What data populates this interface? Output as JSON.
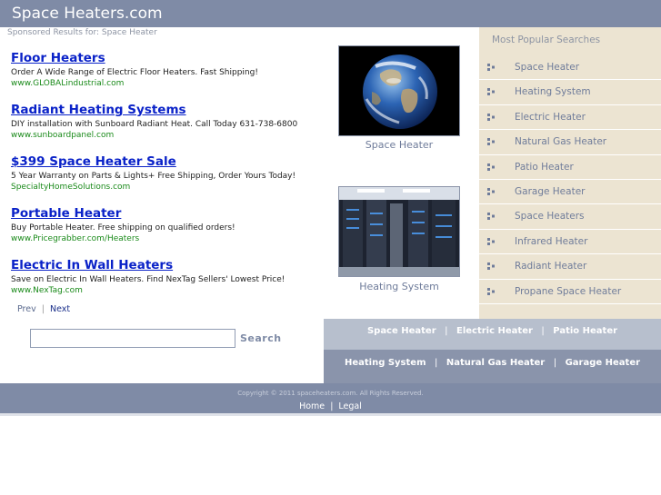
{
  "header": {
    "title": "Space Heaters.com"
  },
  "sponsored_label": "Sponsored Results for: Space Heater",
  "ads": [
    {
      "title": "Floor Heaters",
      "description": "Order A Wide Range of Electric Floor Heaters. Fast Shipping!",
      "url": "www.GLOBALindustrial.com"
    },
    {
      "title": "Radiant Heating Systems",
      "description": "DIY installation with Sunboard Radiant Heat. Call Today 631-738-6800",
      "url": "www.sunboardpanel.com"
    },
    {
      "title": "$399 Space Heater Sale",
      "description": "5 Year Warranty on Parts & Lights+ Free Shipping, Order Yours Today!",
      "url": "SpecialtyHomeSolutions.com"
    },
    {
      "title": "Portable Heater",
      "description": "Buy Portable Heater. Free shipping on qualified orders!",
      "url": "www.Pricegrabber.com/Heaters"
    },
    {
      "title": "Electric In Wall Heaters",
      "description": "Save on Electric In Wall Heaters. Find NexTag Sellers' Lowest Price!",
      "url": "www.NexTag.com"
    }
  ],
  "pager": {
    "prev": "Prev",
    "separator": "|",
    "next": "Next"
  },
  "search": {
    "value": "",
    "button": "Search"
  },
  "thumbnails": [
    {
      "caption": "Space Heater",
      "icon": "earth-image"
    },
    {
      "caption": "Heating System",
      "icon": "server-room-image"
    }
  ],
  "popular": {
    "heading": "Most Popular Searches",
    "items": [
      "Space Heater",
      "Heating System",
      "Electric Heater",
      "Natural Gas Heater",
      "Patio Heater",
      "Garage Heater",
      "Space Heaters",
      "Infrared Heater",
      "Radiant Heater",
      "Propane Space Heater"
    ]
  },
  "bands": {
    "row1": [
      "Space Heater",
      "Electric Heater",
      "Patio Heater"
    ],
    "row2": [
      "Heating System",
      "Natural Gas Heater",
      "Garage Heater"
    ],
    "separator": "|"
  },
  "footer": {
    "copyright": "Copyright © 2011 spaceheaters.com. All Rights Reserved.",
    "links": [
      "Home",
      "Legal"
    ],
    "separator": "|"
  },
  "colors": {
    "header": "#7f8ba6",
    "ad_title": "#0a22c8",
    "ad_url": "#1a8a1a",
    "sidebar": "#ece4d2",
    "band_light": "#b7bfcd",
    "band_dark": "#8a94ab"
  }
}
